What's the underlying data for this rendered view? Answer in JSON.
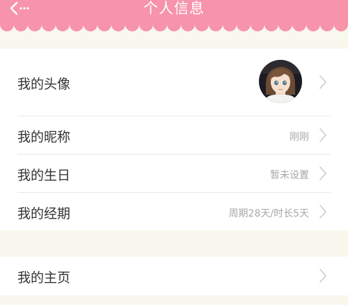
{
  "header": {
    "title": "个人信息",
    "back_icon": "chevron-left-more-icon",
    "color": "#f793ab"
  },
  "section1": {
    "rows": [
      {
        "label": "我的头像",
        "value": "",
        "icon": "avatar-photo"
      },
      {
        "label": "我的昵称",
        "value": "刚刚"
      },
      {
        "label": "我的生日",
        "value": "暂未设置"
      },
      {
        "label": "我的经期",
        "value": "周期28天/时长5天"
      }
    ]
  },
  "section2": {
    "rows": [
      {
        "label": "我的主页",
        "value": ""
      }
    ]
  },
  "colors": {
    "header_pink": "#f793ab",
    "page_background": "#f9f8ee",
    "label_text": "#333333",
    "value_text": "#a8a8a8",
    "chevron": "#cccccc"
  }
}
